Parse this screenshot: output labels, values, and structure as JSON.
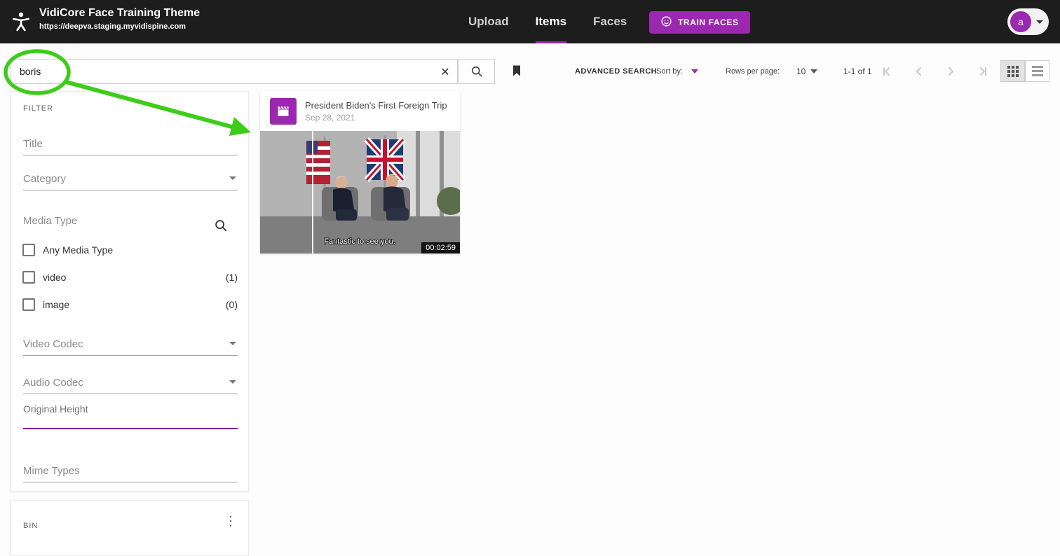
{
  "header": {
    "title": "VidiCore Face Training Theme",
    "subtitle": "https://deepva.staging.myvidispine.com",
    "nav": [
      {
        "label": "Upload"
      },
      {
        "label": "Items"
      },
      {
        "label": "Faces"
      }
    ],
    "train_faces_label": "TRAIN FACES",
    "avatar_letter": "a"
  },
  "toolbar": {
    "search_value": "boris",
    "advanced_search_label": "ADVANCED SEARCH",
    "sort_by_label": "Sort by:",
    "rows_per_page_label": "Rows per page:",
    "rows_per_page_value": "10",
    "range_text": "1-1 of 1"
  },
  "filter_panel": {
    "heading": "FILTER",
    "fields": {
      "title": "Title",
      "category": "Category",
      "media_type": "Media Type",
      "video_codec": "Video Codec",
      "audio_codec": "Audio Codec",
      "original_height": "Original Height",
      "mime_types": "Mime Types"
    },
    "media_types": [
      {
        "label": "Any Media Type",
        "count": ""
      },
      {
        "label": "video",
        "count": "(1)"
      },
      {
        "label": "image",
        "count": "(0)"
      }
    ]
  },
  "bin_panel": {
    "heading": "BIN"
  },
  "results": {
    "items": [
      {
        "title": "President Biden's First Foreign Trip",
        "date": "Sep 28, 2021",
        "duration": "00:02:59",
        "caption": "Fantastic to see you."
      }
    ]
  },
  "icons": {
    "clear": "✕",
    "overflow": "⋮"
  },
  "colors": {
    "accent": "#9C27B0",
    "focus_underline": "#7B1FA2",
    "header_bg": "#1D1D1D",
    "annotation_green": "#3ECC1B"
  }
}
